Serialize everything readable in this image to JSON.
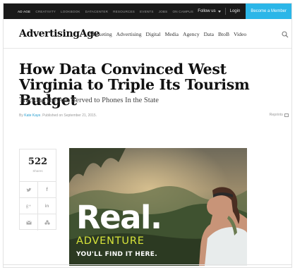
{
  "topbar": {
    "nav": [
      "AD AGE",
      "CREATIVITY",
      "LOOKBOOK",
      "DATACENTER",
      "RESOURCES",
      "EVENTS",
      "JOBS",
      "ON CAMPUS"
    ],
    "follow_label": "Follow us",
    "login_label": "Login",
    "member_button": "Become a Member",
    "member_color": "#2bb6e8"
  },
  "header": {
    "logo": "AdvertisingAge",
    "nav": [
      "Marketing",
      "Advertising",
      "Digital",
      "Media",
      "Agency",
      "Data",
      "BtoB",
      "Video"
    ],
    "search_icon": "search-icon"
  },
  "article": {
    "headline": "How Data Convinced West Virginia to Triple Its Tourism Budget",
    "subhead": "Tracking the Ads Served to Phones In the State",
    "byline_prefix": "By",
    "author": "Kate Kaye",
    "published": ". Published on September 21, 2015.",
    "reprints_label": "Reprints"
  },
  "share": {
    "count": "522",
    "count_label": "Shares",
    "buttons": [
      {
        "icon": "twitter-icon",
        "glyph": "🐦"
      },
      {
        "icon": "facebook-icon",
        "glyph": "f"
      },
      {
        "icon": "google-plus-icon",
        "glyph": "g+"
      },
      {
        "icon": "linkedin-icon",
        "glyph": "in"
      },
      {
        "icon": "email-icon",
        "glyph": "✉"
      },
      {
        "icon": "share-icon",
        "glyph": "☘"
      }
    ]
  },
  "hero": {
    "headline": "Real.",
    "line2": "ADVENTURE",
    "line3": "YOU'LL FIND IT HERE.",
    "accent_color": "#d6e33a"
  }
}
